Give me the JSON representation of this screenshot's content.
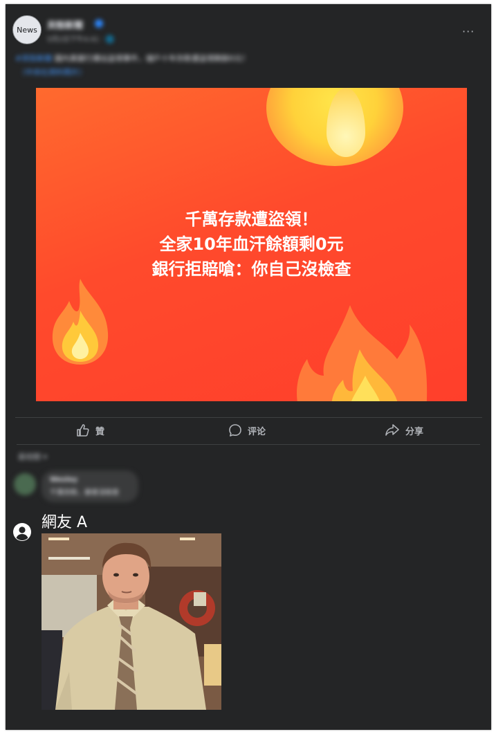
{
  "post": {
    "avatar_text": "News",
    "page_name": "貝殼新聞",
    "post_time": "5月2日下午4:41 · 🌐",
    "caption_tag": "#貝殼新聞",
    "caption_text": "國內某銀行爆出盜領事件，儲戶十年存款遭盜領剩餘0元！",
    "caption_more": "（中央社資料照片）",
    "headline_lines": [
      "千萬存款遭盜領！",
      "全家10年血汗餘額剩0元",
      "銀行拒賠嗆：你自己沒檢查"
    ]
  },
  "actions": {
    "like_label": "贊",
    "comment_label": "评论",
    "share_label": "分享"
  },
  "comments": {
    "sort_label": "最相關 ▾",
    "first": {
      "name": "Wesley",
      "text": "千萬存款，誰會沒檢查"
    },
    "netizen_name": "網友 A"
  },
  "colors": {
    "card_bg": "#242526",
    "image_orange": "#ff4a2c",
    "accent_blue": "#2d88ff"
  }
}
